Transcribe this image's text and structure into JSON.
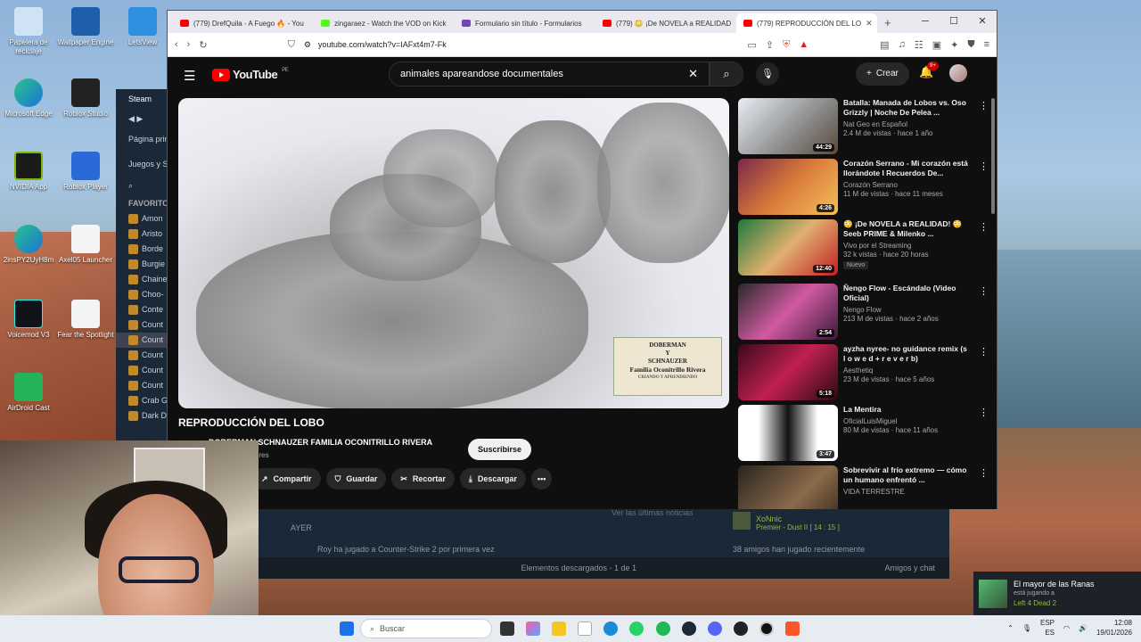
{
  "desktop": {
    "icons": [
      {
        "label": "Papelera de reciclaje"
      },
      {
        "label": "Wallpaper Engine"
      },
      {
        "label": "LetsView"
      },
      {
        "label": "Microsoft Edge"
      },
      {
        "label": "Roblox Studio"
      },
      {
        "label": "NVIDIA App"
      },
      {
        "label": "Roblox Player"
      },
      {
        "label": "2insPY2UyH8m"
      },
      {
        "label": "Axel05 Launcher"
      },
      {
        "label": "Voicemod V3"
      },
      {
        "label": "Fear the Spotlight"
      },
      {
        "label": "AirDroid Cast"
      }
    ]
  },
  "steam": {
    "title": "Steam",
    "main_page": "Página princ",
    "games": "Juegos y So",
    "favorites": "FAVORITO",
    "list": [
      "Amon",
      "Aristo",
      "Borde",
      "Burgie",
      "Chaine",
      "Choo-",
      "Conte",
      "Count",
      "Count",
      "Count",
      "Count",
      "Count",
      "Crab G",
      "Dark D"
    ],
    "yesterday": "AYER",
    "activity": "Roy ha jugado a  Counter-Strike 2 por primera vez",
    "latest_news": "Ver las últimas noticias",
    "friend_name": "XoNnic",
    "friend_status": "Premier - Dust II [ 14 : 15 ]",
    "friends_played": "38 amigos han jugado recientemente",
    "downloads": "Elementos descargados - 1 de 1",
    "friends_chat": "Amigos y chat"
  },
  "browser": {
    "tabs": [
      {
        "label": "(779) DrefQuila - A Fuego 🔥 - You",
        "color": "#ff0000"
      },
      {
        "label": "zingaraez - Watch the VOD on Kick",
        "color": "#53fc18"
      },
      {
        "label": "Formulario sin título - Formularios",
        "color": "#7248b9"
      },
      {
        "label": "(779) 😳 ¡De NOVELA a REALIDAD",
        "color": "#ff0000"
      },
      {
        "label": "(779) REPRODUCCIÓN DEL LO",
        "color": "#ff0000"
      }
    ],
    "url": "youtube.com/watch?v=IAFxt4m7-Fk"
  },
  "youtube": {
    "country": "PE",
    "logo": "YouTube",
    "search_value": "animales apareandose documentales",
    "create_label": "Crear",
    "notif_count": "9+",
    "video_title": "REPRODUCCIÓN DEL LOBO",
    "channel": "DOBERMAN SCHNAUZER FAMILIA OCONITRILLO RIVERA",
    "subs": "ores",
    "subscribe": "Suscribirse",
    "actions": {
      "share": "Compartir",
      "save": "Guardar",
      "clip": "Recortar",
      "download": "Descargar"
    },
    "watermark": {
      "line1": "DOBERMAN",
      "line2": "Y",
      "line3": "SCHNAUZER",
      "line4": "Familia Oconitrillo Rivera",
      "line5": "CRIANDO Y APRENDIENDO"
    },
    "related": [
      {
        "title": "Batalla: Manada de Lobos vs. Oso Grizzly | Noche De Pelea ...",
        "channel": "Nat Geo en Español",
        "views": "2.4 M de vistas · hace 1 año",
        "duration": "44:29",
        "badge": ""
      },
      {
        "title": "Corazón Serrano - Mi corazón está llorándote I Recuerdos De...",
        "channel": "Corazón Serrano",
        "views": "11 M de vistas · hace 11 meses",
        "duration": "4:26",
        "badge": ""
      },
      {
        "title": "😳 ¡De NOVELA a REALIDAD! 😳 Seeb PRIME & Milenko ...",
        "channel": "Vivo por el Streaming",
        "views": "32 k vistas · hace 20 horas",
        "duration": "12:40",
        "badge": "Nuevo"
      },
      {
        "title": "Ñengo Flow - Escándalo (Video Oficial)",
        "channel": "Nengo Flow",
        "views": "213 M de vistas · hace 2 años",
        "duration": "2:54",
        "badge": ""
      },
      {
        "title": "ayzha nyree- no guidance remix (s l o w e d + r e v e r b)",
        "channel": "Aesthetiq",
        "views": "23 M de vistas · hace 5 años",
        "duration": "5:18",
        "badge": ""
      },
      {
        "title": "La Mentira",
        "channel": "OficialLuisMiguel",
        "views": "80 M de vistas · hace 11 años",
        "duration": "3:47",
        "badge": ""
      },
      {
        "title": "Sobrevivir al frío extremo — cómo un humano enfrentó ...",
        "channel": "VIDA TERRESTRE",
        "views": "",
        "duration": "",
        "badge": ""
      }
    ]
  },
  "notification": {
    "name": "El mayor de las Ranas",
    "status": "está jugando a",
    "game": "Left 4 Dead 2"
  },
  "taskbar": {
    "search": "Buscar",
    "lang1": "ESP",
    "lang2": "ES",
    "time": "12:08",
    "date": "19/01/2026"
  }
}
